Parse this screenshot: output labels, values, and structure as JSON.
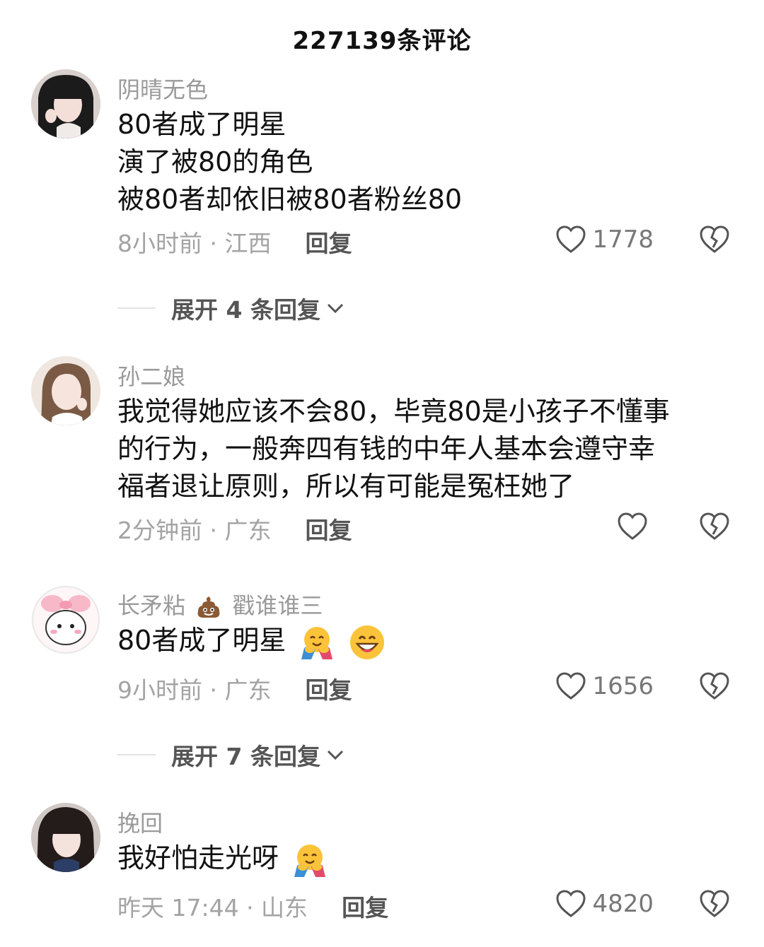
{
  "header": {
    "title": "227139条评论"
  },
  "comments": [
    {
      "username": "阴晴无色",
      "lines": [
        "80者成了明星",
        "演了被80的角色",
        "被80者却依旧被80者粉丝80"
      ],
      "meta": "8小时前 · 江西",
      "reply_label": "回复",
      "likes": "1778",
      "expand_label": "展开 4 条回复"
    },
    {
      "username": "孙二娘",
      "lines": [
        "我觉得她应该不会80，毕竟80是小孩子不懂事",
        "的行为，一般奔四有钱的中年人基本会遵守幸",
        "福者退让原则，所以有可能是冤枉她了"
      ],
      "meta": "2分钟前 · 广东",
      "reply_label": "回复",
      "likes": ""
    },
    {
      "username_prefix": "长矛粘",
      "username_suffix": "戳谁谁三",
      "lines": [
        "80者成了明星"
      ],
      "meta": "9小时前 · 广东",
      "reply_label": "回复",
      "likes": "1656",
      "expand_label": "展开 7 条回复"
    },
    {
      "username": "挽回",
      "lines": [
        "我好怕走光呀"
      ],
      "meta": "昨天 17:44 · 山东",
      "reply_label": "回复",
      "likes": "4820"
    }
  ],
  "colors": {
    "text": "#111111",
    "secondary": "#9a9a9a",
    "icon": "#555555"
  }
}
